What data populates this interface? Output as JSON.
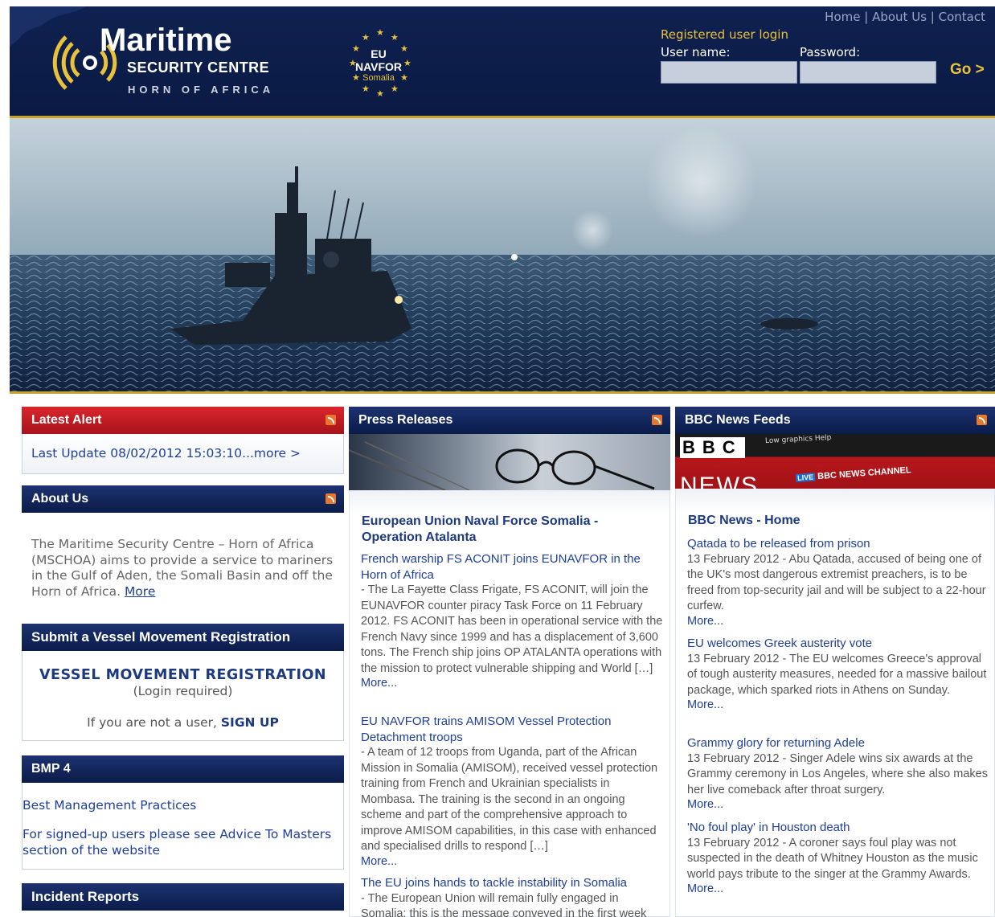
{
  "header": {
    "logo_word": "Maritime",
    "logo_sub1": "SECURITY CENTRE",
    "logo_sub2": "HORN OF AFRICA",
    "eu_logo": {
      "line1": "EU",
      "line2": "NAVFOR",
      "line3": "Somalia"
    },
    "links": [
      "Home",
      "About Us",
      "Contact"
    ],
    "separator": "|",
    "login": {
      "title": "Registered user login",
      "username_label": "User name:",
      "password_label": "Password:",
      "go_label": "Go >"
    }
  },
  "alert": {
    "title": "Latest Alert",
    "text": "Last Update 08/02/2012 15:03:10...more >"
  },
  "about": {
    "title": "About Us",
    "text": "The  Maritime Security Centre – Horn of Africa (MSCHOA) aims to provide a service to mariners in the Gulf of Aden, the Somali Basin and off the Horn of Africa.",
    "more": "More"
  },
  "vessel": {
    "title": "Submit a Vessel Movement Registration",
    "heading": "VESSEL MOVEMENT REGISTRATION",
    "login_required": "(Login required)",
    "signup_prefix": "If you are not a user,",
    "signup_link": "SIGN UP"
  },
  "bmp": {
    "title": "BMP 4",
    "link1": "Best Management Practices",
    "link2": "For signed-up users please see Advice To Masters section of the website"
  },
  "incident": {
    "title": "Incident Reports"
  },
  "press": {
    "title": "Press Releases",
    "heading": "European Union Naval Force Somalia - Operation Atalanta",
    "items": [
      {
        "title": "French warship FS ACONIT joins EUNAVFOR in the Horn of Africa",
        "body": "- The La Fayette Class Frigate, FS ACONIT, will join the EUNAVFOR counter piracy Task Force on 11 February 2012.  FS ACONIT has been in operational service with the French Navy since 1999 and has a displacement of 3,600 tons. The French ship joins OP ATALANTA operations with the mission to protect vulnerable shipping and World […]",
        "more": "More..."
      },
      {
        "title": "EU NAVFOR trains AMISOM Vessel Protection Detachment troops",
        "body": "- A team of 12 troops from Uganda, part of the African Mission in Somalia (AMISOM), received vessel protection training from French and Ukrainian specialists in Mombasa. The training is the second in an ongoing scheme and part of the comprehensive approach to improve AMISOM capabilities, in this case with enhanced and specialised drills to respond […]",
        "more": "More..."
      },
      {
        "title": "The EU joins hands to tackle instability in Somalia",
        "body": "- The European Union will remain fully engaged in Somalia: this is the message conveyed in the first week",
        "more": ""
      }
    ]
  },
  "bbc": {
    "title": "BBC News Feeds",
    "banner": {
      "logo": "BBC",
      "links": "Low graphics   Help",
      "news": "NEWS",
      "live": "LIVE",
      "channel": "BBC NEWS CHANNEL"
    },
    "heading": "BBC News - Home",
    "items": [
      {
        "title": "Qatada to be released from prison",
        "body": "13 February 2012 - Abu Qatada, accused of being one of the UK's most dangerous extremist preachers, is to be freed from top-security jail and will be subject to a 22-hour curfew.",
        "more": "More..."
      },
      {
        "title": "EU welcomes Greek austerity vote",
        "body": "13 February 2012 - The EU welcomes Greece's approval of tough austerity measures, needed for a massive bailout package, which sparked riots in Athens on Sunday.",
        "more": "More..."
      },
      {
        "title": "Grammy glory for returning Adele",
        "body": "13 February 2012 - Singer Adele wins six awards at the Grammy ceremony in Los Angeles, where she also makes her live comeback after throat surgery.",
        "more": "More..."
      },
      {
        "title": "'No foul play' in Houston death",
        "body": "13 February 2012 - A coroner says foul play was not suspected in the death of Whitney Houston as the music world pays tribute to the singer at the Grammy Awards.",
        "more": "More..."
      }
    ]
  },
  "colors": {
    "navy": "#0a1c4a",
    "gold": "#c9a227",
    "alert_red": "#c0141c",
    "link_blue": "#1e3f9a"
  }
}
